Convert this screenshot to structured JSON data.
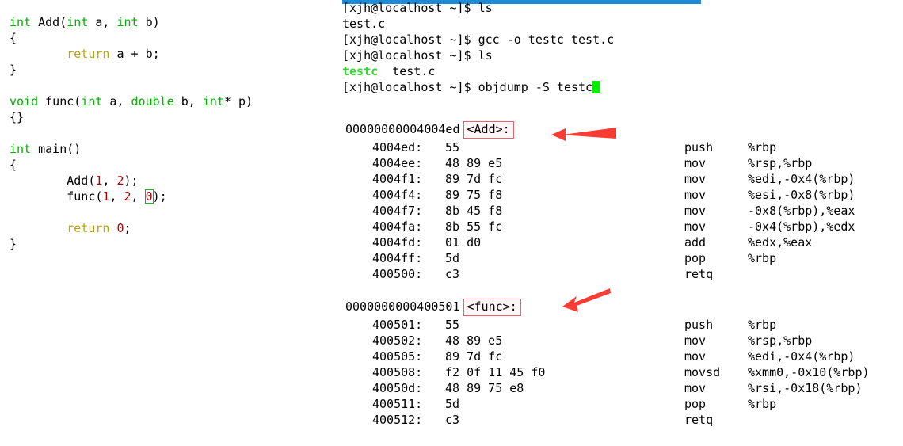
{
  "window": {
    "title_bar_color": "#1e8ad6"
  },
  "colors": {
    "type_keyword": "#00b400",
    "return_keyword": "#b8a50a",
    "number_literal": "#b00000",
    "terminal_executable": "#33d633",
    "terminal_cursor": "#00ee00",
    "annotation_red": "#fa3c32",
    "symbol_box_border": "#e8636b",
    "editor_cursor_outline": "#00c000"
  },
  "code_panel": {
    "language": "c",
    "lines": [
      {
        "segments": [
          {
            "t": "int",
            "c": "type"
          },
          {
            "t": " Add(",
            "c": "plain"
          },
          {
            "t": "int",
            "c": "type"
          },
          {
            "t": " a, ",
            "c": "plain"
          },
          {
            "t": "int",
            "c": "type"
          },
          {
            "t": " b)",
            "c": "plain"
          }
        ]
      },
      {
        "segments": [
          {
            "t": "{",
            "c": "plain"
          }
        ]
      },
      {
        "segments": [
          {
            "t": "        ",
            "c": "plain"
          },
          {
            "t": "return",
            "c": "keyword"
          },
          {
            "t": " a + b;",
            "c": "plain"
          }
        ]
      },
      {
        "segments": [
          {
            "t": "}",
            "c": "plain"
          }
        ]
      },
      {
        "segments": [
          {
            "t": "",
            "c": "plain"
          }
        ]
      },
      {
        "segments": [
          {
            "t": "void",
            "c": "type"
          },
          {
            "t": " func(",
            "c": "plain"
          },
          {
            "t": "int",
            "c": "type"
          },
          {
            "t": " a, ",
            "c": "plain"
          },
          {
            "t": "double",
            "c": "type"
          },
          {
            "t": " b, ",
            "c": "plain"
          },
          {
            "t": "int",
            "c": "type"
          },
          {
            "t": "* p)",
            "c": "plain"
          }
        ]
      },
      {
        "segments": [
          {
            "t": "{}",
            "c": "plain"
          }
        ]
      },
      {
        "segments": [
          {
            "t": "",
            "c": "plain"
          }
        ]
      },
      {
        "segments": [
          {
            "t": "int",
            "c": "type"
          },
          {
            "t": " main()",
            "c": "plain"
          }
        ]
      },
      {
        "segments": [
          {
            "t": "{",
            "c": "plain"
          }
        ]
      },
      {
        "segments": [
          {
            "t": "        Add(",
            "c": "plain"
          },
          {
            "t": "1",
            "c": "number"
          },
          {
            "t": ", ",
            "c": "plain"
          },
          {
            "t": "2",
            "c": "number"
          },
          {
            "t": ");",
            "c": "plain"
          }
        ]
      },
      {
        "segments": [
          {
            "t": "        func(",
            "c": "plain"
          },
          {
            "t": "1",
            "c": "number"
          },
          {
            "t": ", ",
            "c": "plain"
          },
          {
            "t": "2",
            "c": "number"
          },
          {
            "t": ", ",
            "c": "plain"
          },
          {
            "t": "0",
            "c": "cursor"
          },
          {
            "t": ");",
            "c": "plain"
          }
        ]
      },
      {
        "segments": [
          {
            "t": "",
            "c": "plain"
          }
        ]
      },
      {
        "segments": [
          {
            "t": "        ",
            "c": "plain"
          },
          {
            "t": "return",
            "c": "keyword"
          },
          {
            "t": " ",
            "c": "plain"
          },
          {
            "t": "0",
            "c": "number"
          },
          {
            "t": ";",
            "c": "plain"
          }
        ]
      },
      {
        "segments": [
          {
            "t": "}",
            "c": "plain"
          }
        ]
      }
    ]
  },
  "terminal": {
    "prompt": "[xjh@localhost ~]$",
    "lines": [
      {
        "type": "command",
        "prompt": "[xjh@localhost ~]$",
        "command": " ls"
      },
      {
        "type": "output",
        "text": "test.c"
      },
      {
        "type": "command",
        "prompt": "[xjh@localhost ~]$",
        "command": " gcc -o testc test.c"
      },
      {
        "type": "command",
        "prompt": "[xjh@localhost ~]$",
        "command": " ls"
      },
      {
        "type": "ls-output",
        "executable": "testc",
        "gap": "  ",
        "plain": "test.c"
      },
      {
        "type": "command-cursor",
        "prompt": "[xjh@localhost ~]$",
        "command": " objdump -S testc"
      }
    ]
  },
  "disassembly": {
    "blocks": [
      {
        "address": "00000000004004ed",
        "symbol": "<Add>:",
        "annotated": true,
        "rows": [
          {
            "addr": "4004ed:",
            "bytes": "55",
            "mnemonic": "push",
            "operands": "%rbp"
          },
          {
            "addr": "4004ee:",
            "bytes": "48 89 e5",
            "mnemonic": "mov",
            "operands": "%rsp,%rbp"
          },
          {
            "addr": "4004f1:",
            "bytes": "89 7d fc",
            "mnemonic": "mov",
            "operands": "%edi,-0x4(%rbp)"
          },
          {
            "addr": "4004f4:",
            "bytes": "89 75 f8",
            "mnemonic": "mov",
            "operands": "%esi,-0x8(%rbp)"
          },
          {
            "addr": "4004f7:",
            "bytes": "8b 45 f8",
            "mnemonic": "mov",
            "operands": "-0x8(%rbp),%eax"
          },
          {
            "addr": "4004fa:",
            "bytes": "8b 55 fc",
            "mnemonic": "mov",
            "operands": "-0x4(%rbp),%edx"
          },
          {
            "addr": "4004fd:",
            "bytes": "01 d0",
            "mnemonic": "add",
            "operands": "%edx,%eax"
          },
          {
            "addr": "4004ff:",
            "bytes": "5d",
            "mnemonic": "pop",
            "operands": "%rbp"
          },
          {
            "addr": "400500:",
            "bytes": "c3",
            "mnemonic": "retq",
            "operands": ""
          }
        ]
      },
      {
        "address": "0000000000400501",
        "symbol": "<func>:",
        "annotated": true,
        "rows": [
          {
            "addr": "400501:",
            "bytes": "55",
            "mnemonic": "push",
            "operands": "%rbp"
          },
          {
            "addr": "400502:",
            "bytes": "48 89 e5",
            "mnemonic": "mov",
            "operands": "%rsp,%rbp"
          },
          {
            "addr": "400505:",
            "bytes": "89 7d fc",
            "mnemonic": "mov",
            "operands": "%edi,-0x4(%rbp)"
          },
          {
            "addr": "400508:",
            "bytes": "f2 0f 11 45 f0",
            "mnemonic": "movsd",
            "operands": "%xmm0,-0x10(%rbp)"
          },
          {
            "addr": "40050d:",
            "bytes": "48 89 75 e8",
            "mnemonic": "mov",
            "operands": "%rsi,-0x18(%rbp)"
          },
          {
            "addr": "400511:",
            "bytes": "5d",
            "mnemonic": "pop",
            "operands": "%rbp"
          },
          {
            "addr": "400512:",
            "bytes": "c3",
            "mnemonic": "retq",
            "operands": ""
          }
        ]
      }
    ]
  },
  "annotations": {
    "arrows": [
      {
        "name": "arrow-to-add-symbol",
        "style": "horizontal"
      },
      {
        "name": "arrow-to-func-symbol",
        "style": "diagonal"
      }
    ]
  }
}
